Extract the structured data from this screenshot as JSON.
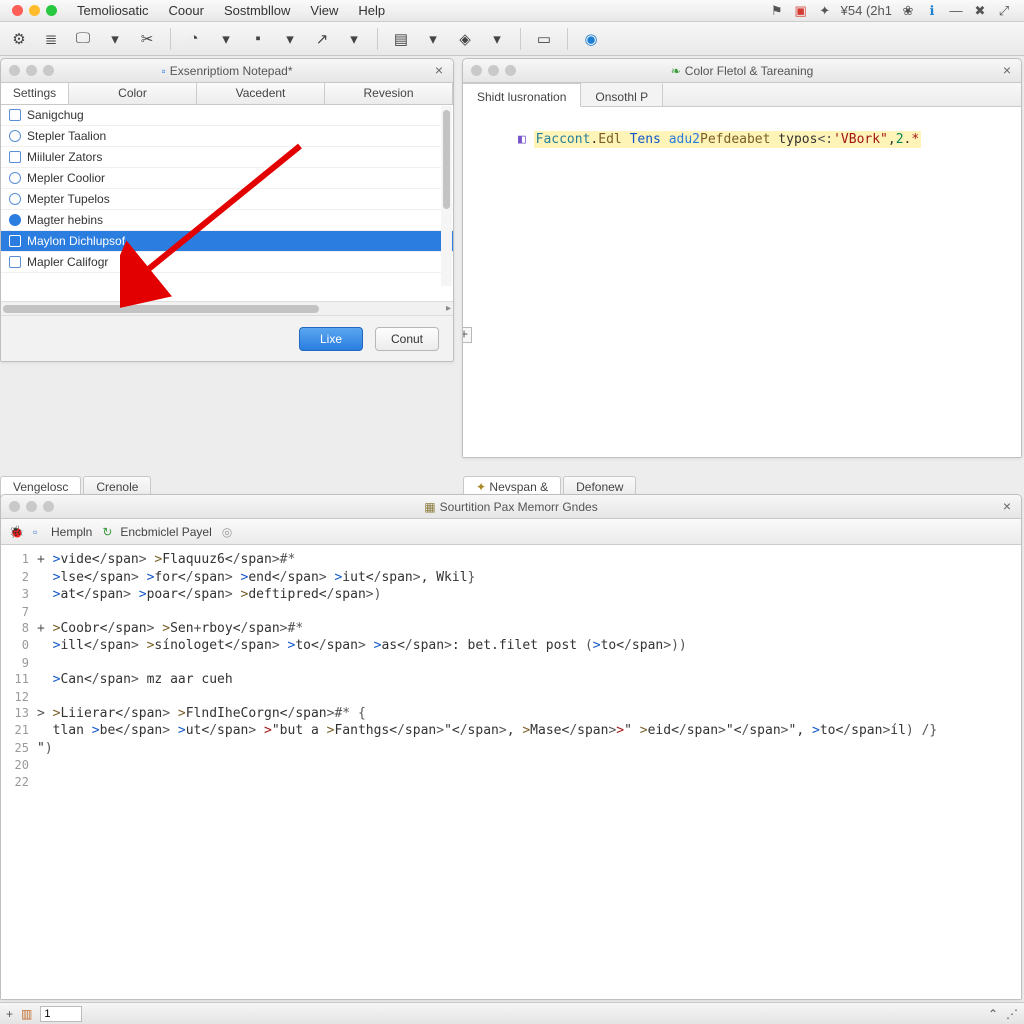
{
  "menubar": {
    "items": [
      "Temoliosatic",
      "Coour",
      "Sostmbllow",
      "View",
      "Help"
    ],
    "right_text": "¥54  (2h1"
  },
  "panels": {
    "left": {
      "title": "Exsenriptiom Notepad*",
      "tabs": [
        "Settings",
        "Color",
        "Vacedent",
        "Revesion"
      ],
      "items": [
        {
          "icon": "square",
          "label": "Sanigchug"
        },
        {
          "icon": "circle",
          "label": "Stepler Taalion"
        },
        {
          "icon": "square",
          "label": "Miiluler Zators"
        },
        {
          "icon": "circle",
          "label": "Mepler Coolior"
        },
        {
          "icon": "circle",
          "label": "Mepter Tupelos"
        },
        {
          "icon": "circle-f",
          "label": "Magter hebins"
        },
        {
          "icon": "square-f",
          "label": "Maylon Dichlupsof",
          "selected": true
        },
        {
          "icon": "square",
          "label": "Mapler Califogr"
        }
      ],
      "btn_primary": "Lixe",
      "btn_secondary": "Conut"
    },
    "right": {
      "title": "Color Fletol & Tareaning",
      "tabs": [
        "Shidt lusronation",
        "Onsothl P"
      ],
      "code": "Faccont.Edl Tens adu2Pefdeabet typos<:'VBork\",2.*"
    },
    "bottom": {
      "title": "Sourtition Pax Memorr Gndes",
      "chips": [
        "Hempln",
        "Encbmiclel Payel"
      ],
      "left_tabs": [
        "Vengelosc",
        "Crenole"
      ],
      "right_tabs": [
        "Nevspan &",
        "Defonew"
      ],
      "code_lines": [
        {
          "n": "1",
          "t": "+ vide Flaquuz6#*"
        },
        {
          "n": "2",
          "t": "  lse for end iut, Wkil}"
        },
        {
          "n": "3",
          "t": "  at poar deftipred)"
        },
        {
          "n": "7",
          "t": ""
        },
        {
          "n": "8",
          "t": "+ Coobr Sen+rboy#*"
        },
        {
          "n": "0",
          "t": "  ill sínologet to as: bet.filet post (to))"
        },
        {
          "n": "9",
          "t": ""
        },
        {
          "n": "11",
          "t": "  Can mz aar cueh"
        },
        {
          "n": "12",
          "t": ""
        },
        {
          "n": "13",
          "t": "> Liierar FlndIheCorgn#* {"
        },
        {
          "n": "21",
          "t": "  tlan be ut \"but a Fanthgs\", Mase\" eid\"\", toíl) /}"
        },
        {
          "n": "25",
          "t": "\")"
        },
        {
          "n": "20",
          "t": ""
        },
        {
          "n": "22",
          "t": ""
        }
      ]
    }
  },
  "statusbar": {
    "page": "1"
  }
}
